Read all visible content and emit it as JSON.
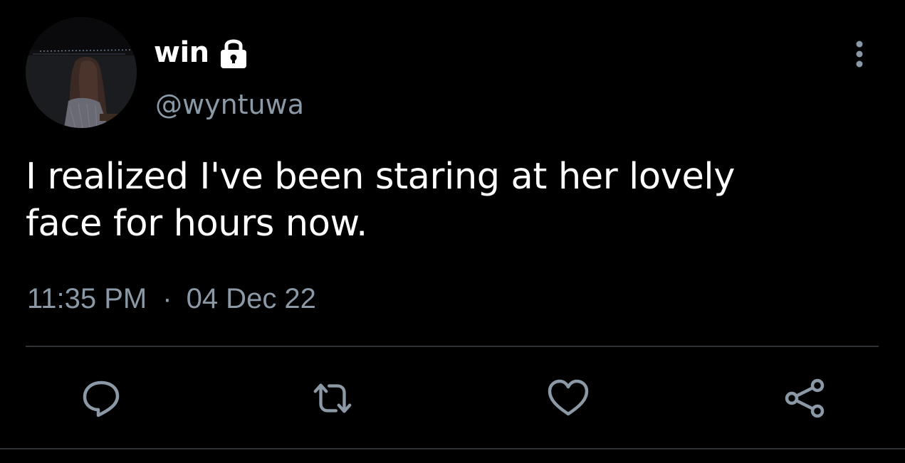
{
  "user": {
    "display_name": "win",
    "handle": "@wyntuwa",
    "protected_icon": "lock-icon",
    "avatar": "profile-photo"
  },
  "tweet": {
    "text_line1": "I realized I've been staring at her lovely",
    "text_line2": "face for hours now.",
    "time": "11:35 PM",
    "separator": "·",
    "date": "04 Dec 22"
  },
  "menu": {
    "icon": "more-vertical-icon"
  },
  "actions": [
    {
      "name": "reply",
      "icon": "reply-icon"
    },
    {
      "name": "retweet",
      "icon": "retweet-icon"
    },
    {
      "name": "like",
      "icon": "heart-icon"
    },
    {
      "name": "share",
      "icon": "share-icon"
    }
  ],
  "colors": {
    "background": "#000000",
    "primary_text": "#ffffff",
    "secondary_text": "#8b98a5",
    "divider": "#2f3336",
    "icon": "#8b98a5"
  }
}
